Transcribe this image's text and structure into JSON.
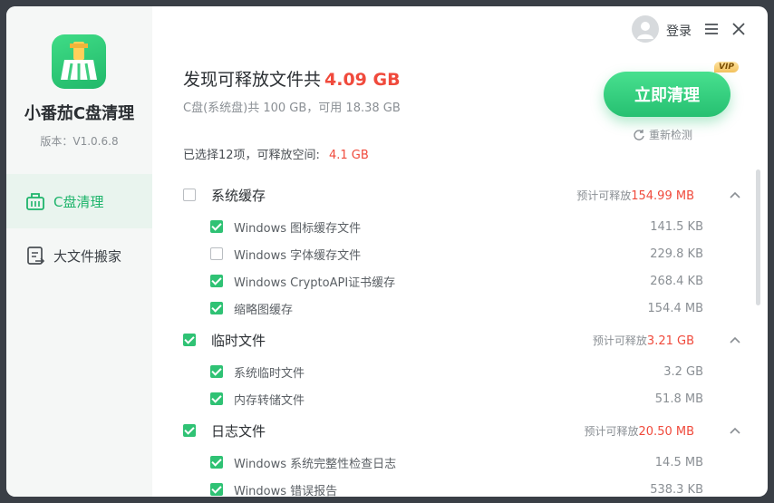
{
  "app": {
    "name": "小番茄C盘清理",
    "version": "版本：V1.0.6.8"
  },
  "nav": [
    {
      "label": "C盘清理",
      "icon": "broom-icon",
      "active": true
    },
    {
      "label": "大文件搬家",
      "icon": "file-move-icon",
      "active": false
    }
  ],
  "topbar": {
    "login_label": "登录",
    "menu_icon": "menu-icon",
    "close_icon": "close-icon"
  },
  "header": {
    "title_prefix": "发现可释放文件共",
    "total_size": "4.09 GB",
    "disk_info": "C盘(系统盘)共 100 GB，可用 18.38 GB",
    "selected_prefix": "已选择12项，可释放空间:",
    "selected_size": "4.1 GB"
  },
  "actions": {
    "clean_label": "立即清理",
    "vip_badge": "VIP",
    "recheck_label": "重新检测"
  },
  "categories": [
    {
      "label": "系统缓存",
      "checked": false,
      "est_label": "预计可释放",
      "est_size": "154.99 MB",
      "items": [
        {
          "label": "Windows 图标缓存文件",
          "size": "141.5 KB",
          "checked": true
        },
        {
          "label": "Windows 字体缓存文件",
          "size": "229.8 KB",
          "checked": false
        },
        {
          "label": "Windows CryptoAPI证书缓存",
          "size": "268.4 KB",
          "checked": true
        },
        {
          "label": "缩略图缓存",
          "size": "154.4 MB",
          "checked": true
        }
      ]
    },
    {
      "label": "临时文件",
      "checked": true,
      "est_label": "预计可释放",
      "est_size": "3.21 GB",
      "items": [
        {
          "label": "系统临时文件",
          "size": "3.2 GB",
          "checked": true
        },
        {
          "label": "内存转储文件",
          "size": "51.8 MB",
          "checked": true
        }
      ]
    },
    {
      "label": "日志文件",
      "checked": true,
      "est_label": "预计可释放",
      "est_size": "20.50 MB",
      "items": [
        {
          "label": "Windows 系统完整性检查日志",
          "size": "14.5 MB",
          "checked": true
        },
        {
          "label": "Windows 错误报告",
          "size": "538.3 KB",
          "checked": true
        }
      ]
    }
  ],
  "colors": {
    "accent": "#2fc274",
    "highlight": "#f04a3c"
  }
}
